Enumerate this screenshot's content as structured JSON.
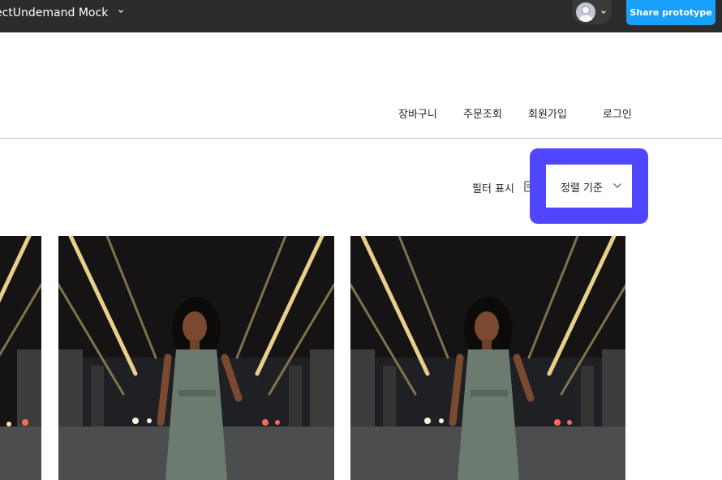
{
  "app": {
    "project_title": "ectUndemand Mock",
    "share_label": "Share prototype"
  },
  "site_nav": {
    "items": [
      "장바구니",
      "주문조회",
      "회원가입",
      "로그인"
    ]
  },
  "toolbar": {
    "filter_label": "필터 표시",
    "sort_label": "정렬 기준"
  },
  "colors": {
    "topbar": "#2c2c2c",
    "share_button": "#18a0fb",
    "sort_highlight": "#5046ff"
  },
  "icons": [
    "chevron-down-icon",
    "avatar-icon",
    "filter-icon",
    "sort-chevron-icon"
  ]
}
